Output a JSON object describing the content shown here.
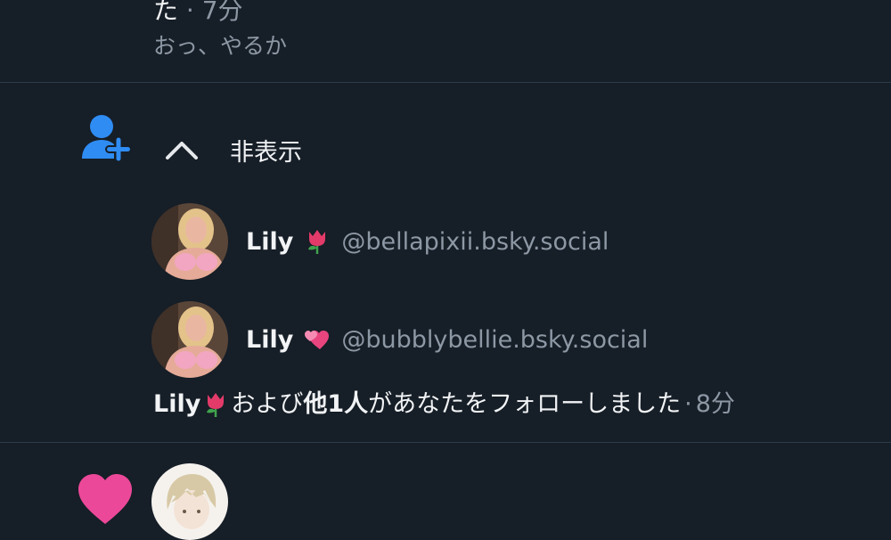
{
  "prev_notification": {
    "line_fragment": "た",
    "separator": "·",
    "time": "7分",
    "reply_text": "おっ、やるか"
  },
  "follow_notification": {
    "collapse_label": "非表示",
    "users": [
      {
        "name": "Lily",
        "emoji": "tulip",
        "handle": "@bellapixii.bsky.social"
      },
      {
        "name": "Lily",
        "emoji": "revolving-hearts",
        "handle": "@bubblybellie.bsky.social"
      }
    ],
    "summary": {
      "name": "Lily",
      "conjunction": "および",
      "others": "他1人",
      "action": "があなたをフォローしました",
      "separator": "·",
      "time": "8分"
    }
  },
  "colors": {
    "background": "#161e27",
    "accent_blue": "#2f8cf3",
    "like_pink": "#ec4899",
    "muted_text": "#8d98a5",
    "divider": "#2e3b49"
  },
  "icons": [
    "person-plus-icon",
    "chevron-up-icon",
    "heart-icon"
  ]
}
